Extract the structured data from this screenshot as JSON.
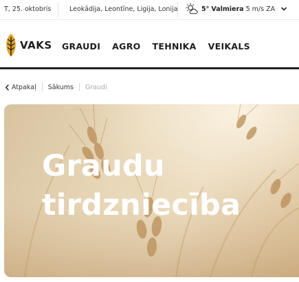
{
  "topbar": {
    "date": "T, 25. oktobris",
    "namedays": "Leokādija, Leontīne, Ligija, Lonija",
    "weather": {
      "icon": "partly-cloudy-icon",
      "temperature": "5°",
      "city": "Valmiera",
      "wind": "5 m/s ZA"
    }
  },
  "logo": {
    "text": "VAKS",
    "icon": "grain-leaf-logo"
  },
  "nav": {
    "items": [
      {
        "label": "GRAUDI"
      },
      {
        "label": "AGRO"
      },
      {
        "label": "TEHNIKA"
      },
      {
        "label": "VEIKALS"
      }
    ]
  },
  "breadcrumb": {
    "back": "Atpakaļ",
    "home": "Sākums",
    "current": "Graudi"
  },
  "hero": {
    "title_line1": "Graudu",
    "title_line2": "tirdzniecība"
  },
  "colors": {
    "logo_gold": "#e0a42a",
    "text_dark": "#1d1d1d",
    "breadcrumb_current": "#a9a9a9"
  }
}
